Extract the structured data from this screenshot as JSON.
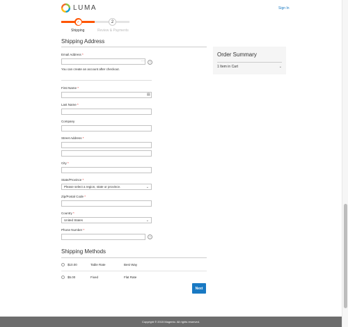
{
  "header": {
    "logo_text": "LUMA",
    "sign_in": "Sign In"
  },
  "progress": {
    "steps": [
      {
        "number": "1",
        "label": "Shipping",
        "state": "done"
      },
      {
        "number": "2",
        "label": "Review & Payments",
        "state": "pending"
      }
    ]
  },
  "shipping_address": {
    "title": "Shipping Address",
    "email": {
      "label": "Email Address",
      "required": "*",
      "value": "",
      "note": "You can create an account after checkout."
    },
    "first_name": {
      "label": "First Name",
      "required": "*",
      "value": ""
    },
    "last_name": {
      "label": "Last Name",
      "required": "*",
      "value": ""
    },
    "company": {
      "label": "Company",
      "value": ""
    },
    "street": {
      "label": "Street Address",
      "required": "*",
      "line1": "",
      "line2": ""
    },
    "city": {
      "label": "City",
      "required": "*",
      "value": ""
    },
    "state": {
      "label": "State/Province",
      "required": "*",
      "value": "Please select a region, state or province."
    },
    "zip": {
      "label": "Zip/Postal Code",
      "required": "*",
      "value": ""
    },
    "country": {
      "label": "Country",
      "required": "*",
      "value": "United States"
    },
    "phone": {
      "label": "Phone Number",
      "required": "*",
      "value": ""
    },
    "help_icon": "?"
  },
  "order_summary": {
    "title": "Order Summary",
    "items": "1 Item in Cart"
  },
  "shipping_methods": {
    "title": "Shipping Methods",
    "rows": [
      {
        "price": "$10.00",
        "method": "Table Rate",
        "carrier": "Best Way"
      },
      {
        "price": "$5.00",
        "method": "Fixed",
        "carrier": "Flat Rate"
      }
    ]
  },
  "next_button": "Next",
  "footer": {
    "copyright": "Copyright © 2015 Magento. All rights reserved."
  },
  "colors": {
    "accent": "#ff5501",
    "button": "#1979c3",
    "footer": "#6d6d6d"
  }
}
